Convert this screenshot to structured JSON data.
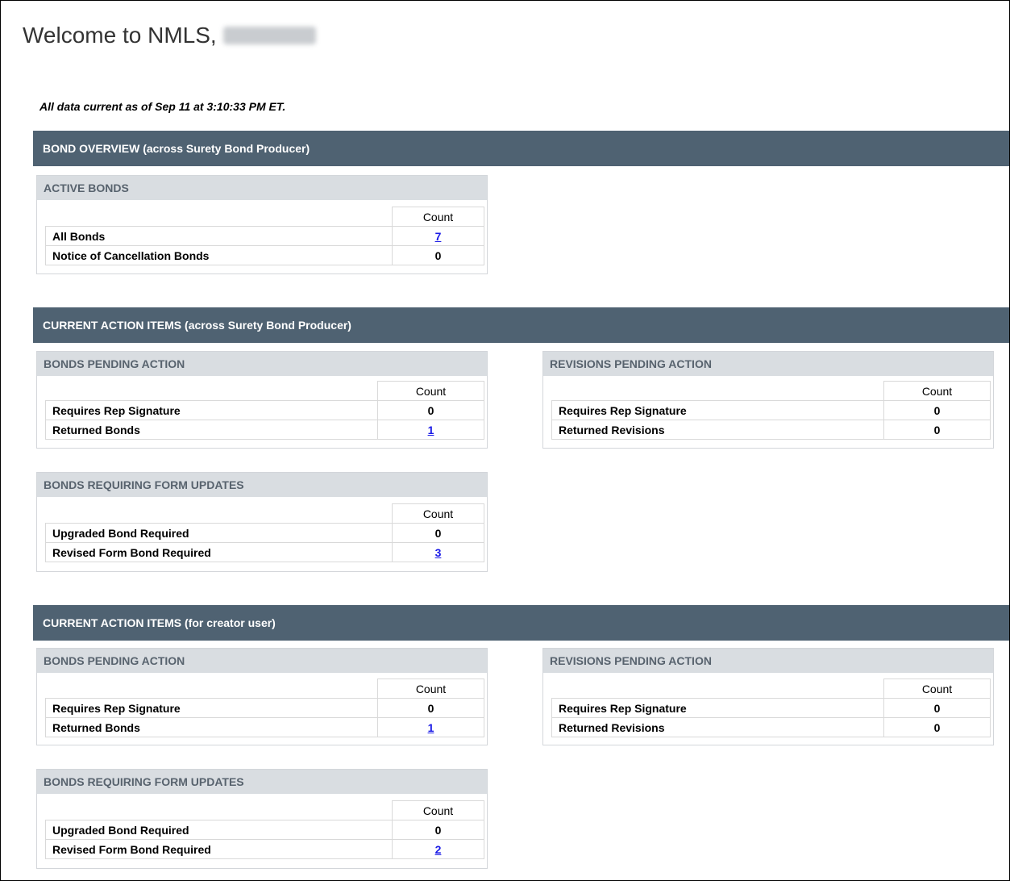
{
  "header": {
    "welcome_text": "Welcome to NMLS,"
  },
  "as_of_text": "All data current as of Sep 11 at 3:10:33 PM ET.",
  "count_header": "Count",
  "bond_overview": {
    "title": "BOND OVERVIEW (across Surety Bond Producer)",
    "active_bonds": {
      "title": "ACTIVE BONDS",
      "rows": [
        {
          "label": "All Bonds",
          "count": "7",
          "link": true
        },
        {
          "label": "Notice of Cancellation Bonds",
          "count": "0",
          "link": false
        }
      ]
    }
  },
  "sbp_action_items": {
    "title": "CURRENT ACTION ITEMS (across Surety Bond Producer)",
    "bonds_pending": {
      "title": "BONDS PENDING ACTION",
      "rows": [
        {
          "label": "Requires Rep Signature",
          "count": "0",
          "link": false
        },
        {
          "label": "Returned Bonds",
          "count": "1",
          "link": true
        }
      ]
    },
    "revisions_pending": {
      "title": "REVISIONS PENDING ACTION",
      "rows": [
        {
          "label": "Requires Rep Signature",
          "count": "0",
          "link": false
        },
        {
          "label": "Returned Revisions",
          "count": "0",
          "link": false
        }
      ]
    },
    "form_updates": {
      "title": "BONDS REQUIRING FORM UPDATES",
      "rows": [
        {
          "label": "Upgraded Bond Required",
          "count": "0",
          "link": false
        },
        {
          "label": "Revised Form Bond Required",
          "count": "3",
          "link": true
        }
      ]
    }
  },
  "creator_action_items": {
    "title": "CURRENT ACTION ITEMS (for creator user)",
    "bonds_pending": {
      "title": "BONDS PENDING ACTION",
      "rows": [
        {
          "label": "Requires Rep Signature",
          "count": "0",
          "link": false
        },
        {
          "label": "Returned Bonds",
          "count": "1",
          "link": true
        }
      ]
    },
    "revisions_pending": {
      "title": "REVISIONS PENDING ACTION",
      "rows": [
        {
          "label": "Requires Rep Signature",
          "count": "0",
          "link": false
        },
        {
          "label": "Returned Revisions",
          "count": "0",
          "link": false
        }
      ]
    },
    "form_updates": {
      "title": "BONDS REQUIRING FORM UPDATES",
      "rows": [
        {
          "label": "Upgraded Bond Required",
          "count": "0",
          "link": false
        },
        {
          "label": "Revised Form Bond Required",
          "count": "2",
          "link": true
        }
      ]
    }
  }
}
